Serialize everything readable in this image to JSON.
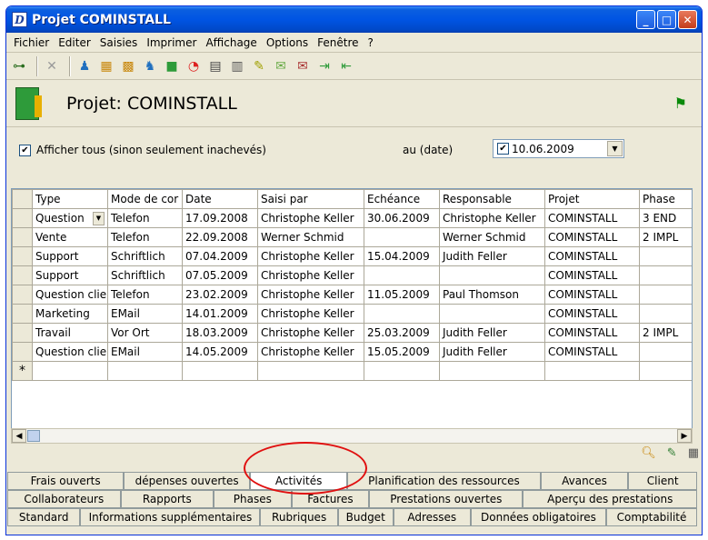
{
  "window": {
    "title": "Projet COMINSTALL",
    "app_icon_letter": "D",
    "controls": [
      "minimize",
      "maximize",
      "close"
    ]
  },
  "menu": [
    "Fichier",
    "Editer",
    "Saisies",
    "Imprimer",
    "Affichage",
    "Options",
    "Fenêtre",
    "?"
  ],
  "toolbar_icons": [
    "tree-icon",
    "delete-icon",
    "person-icon",
    "building-icon",
    "building-group-icon",
    "people-icon",
    "green-box-icon",
    "pie-chart-icon",
    "notebook-icon",
    "document-icon",
    "stamp-icon",
    "mail-open-icon",
    "mail-icon",
    "export-icon",
    "import-icon"
  ],
  "header": {
    "title": "Projet: COMINSTALL"
  },
  "filter": {
    "show_all_label": "Afficher tous (sinon seulement inachevés)",
    "show_all_checked": true,
    "date_label": "au (date)",
    "date_value": "10.06.2009",
    "date_checked": true
  },
  "grid": {
    "columns": [
      "Type",
      "Mode de cor",
      "Date",
      "Saisi par",
      "Echéance",
      "Responsable",
      "Projet",
      "Phase"
    ],
    "rows": [
      [
        "Question",
        "Telefon",
        "17.09.2008",
        "Christophe Keller",
        "30.06.2009",
        "Christophe Keller",
        "COMINSTALL",
        "3 END"
      ],
      [
        "Vente",
        "Telefon",
        "22.09.2008",
        "Werner Schmid",
        "",
        "Werner Schmid",
        "COMINSTALL",
        "2 IMPL"
      ],
      [
        "Support",
        "Schriftlich",
        "07.04.2009",
        "Christophe Keller",
        "15.04.2009",
        "Judith Feller",
        "COMINSTALL",
        ""
      ],
      [
        "Support",
        "Schriftlich",
        "07.05.2009",
        "Christophe Keller",
        "",
        "",
        "COMINSTALL",
        ""
      ],
      [
        "Question clie",
        "Telefon",
        "23.02.2009",
        "Christophe Keller",
        "11.05.2009",
        "Paul Thomson",
        "COMINSTALL",
        ""
      ],
      [
        "Marketing",
        "EMail",
        "14.01.2009",
        "Christophe Keller",
        "",
        "",
        "COMINSTALL",
        ""
      ],
      [
        "Travail",
        "Vor Ort",
        "18.03.2009",
        "Christophe Keller",
        "25.03.2009",
        "Judith Feller",
        "COMINSTALL",
        "2 IMPL"
      ],
      [
        "Question clie",
        "EMail",
        "14.05.2009",
        "Christophe Keller",
        "15.05.2009",
        "Judith Feller",
        "COMINSTALL",
        ""
      ]
    ],
    "new_row_marker": "*"
  },
  "tabs": {
    "row1": [
      "Frais ouverts",
      "dépenses ouvertes",
      "Activités",
      "Planification des ressources",
      "Avances",
      "Client"
    ],
    "row2": [
      "Collaborateurs",
      "Rapports",
      "Phases",
      "Factures",
      "Prestations ouvertes",
      "Aperçu des prestations"
    ],
    "row3": [
      "Standard",
      "Informations supplémentaires",
      "Rubriques",
      "Budget",
      "Adresses",
      "Données obligatoires",
      "Comptabilité"
    ],
    "active": "Activités"
  }
}
